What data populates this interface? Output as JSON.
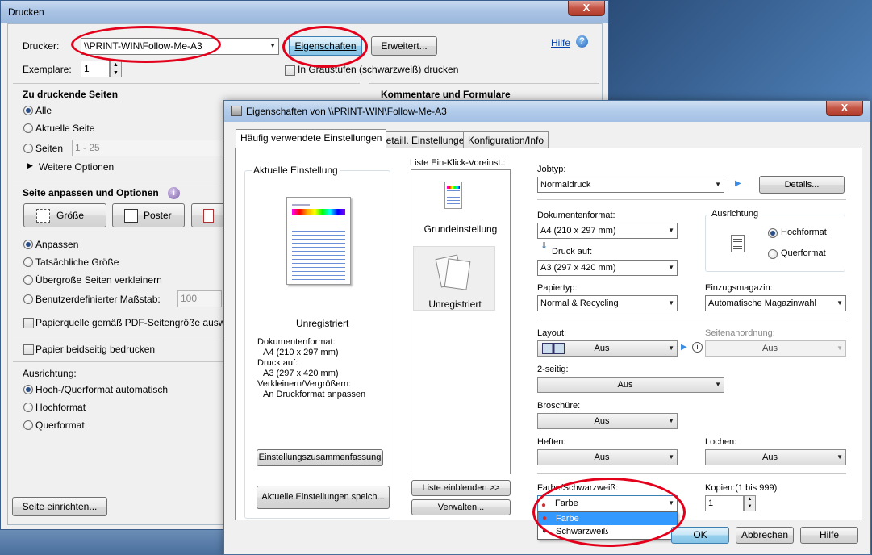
{
  "print_dialog": {
    "title": "Drucken",
    "close": "X",
    "printer_label": "Drucker:",
    "printer_value": "\\\\PRINT-WIN\\Follow-Me-A3",
    "properties_button": "Eigenschaften",
    "advanced_button": "Erweitert...",
    "help_link": "Hilfe",
    "copies_label": "Exemplare:",
    "copies_value": "1",
    "grayscale_label": "In Graustufen (schwarzweiß) drucken",
    "pages_heading": "Zu druckende Seiten",
    "pages_all": "Alle",
    "pages_current": "Aktuelle Seite",
    "pages_pages": "Seiten",
    "pages_range": "1 - 25",
    "more_options": "Weitere Optionen",
    "comments_heading": "Kommentare und Formulare",
    "fit_heading": "Seite anpassen und Optionen",
    "size_button": "Größe",
    "poster_button": "Poster",
    "fit_adjust": "Anpassen",
    "fit_actual": "Tatsächliche Größe",
    "fit_shrink": "Übergroße Seiten verkleinern",
    "fit_custom": "Benutzerdefinierter Maßstab:",
    "fit_custom_value": "100",
    "paper_source": "Papierquelle gemäß PDF-Seitengröße auswä",
    "duplex": "Papier beidseitig bedrucken",
    "orientation_label": "Ausrichtung:",
    "orient_auto": "Hoch-/Querformat automatisch",
    "orient_portrait": "Hochformat",
    "orient_landscape": "Querformat",
    "page_setup_button": "Seite einrichten..."
  },
  "properties_dialog": {
    "title": "Eigenschaften von \\\\PRINT-WIN\\Follow-Me-A3",
    "close": "X",
    "tabs": [
      "Häufig verwendete Einstellungen",
      "Detaill. Einstellungen",
      "Konfiguration/Info"
    ],
    "current_setting_title": "Aktuelle Einstellung",
    "unregistered": "Unregistriert",
    "summary_lines": [
      "Dokumentenformat:",
      "A4 (210 x 297 mm)",
      "Druck auf:",
      "A3 (297 x 420 mm)",
      "Verkleinern/Vergrößern:",
      "An Druckformat anpassen"
    ],
    "summary_button": "Einstellungszusammenfassung",
    "save_button": "Aktuelle Einstellungen speich...",
    "oneclick_title": "Liste Ein-Klick-Voreinst.:",
    "oneclick_items": [
      "Grundeinstellung",
      "Unregistriert"
    ],
    "show_list_button": "Liste einblenden >>",
    "manage_button": "Verwalten...",
    "jobtype_label": "Jobtyp:",
    "jobtype_value": "Normaldruck",
    "details_button": "Details...",
    "docformat_label": "Dokumentenformat:",
    "docformat_value": "A4 (210 x 297 mm)",
    "printon_label": "Druck auf:",
    "printon_value": "A3 (297 x 420 mm)",
    "orientation_title": "Ausrichtung",
    "orient_portrait": "Hochformat",
    "orient_landscape": "Querformat",
    "papertype_label": "Papiertyp:",
    "papertype_value": "Normal & Recycling",
    "tray_label": "Einzugsmagazin:",
    "tray_value": "Automatische Magazinwahl",
    "layout_label": "Layout:",
    "layout_value": "Aus",
    "pageorder_label": "Seitenanordnung:",
    "pageorder_value": "Aus",
    "duplex_label": "2-seitig:",
    "duplex_value": "Aus",
    "booklet_label": "Broschüre:",
    "booklet_value": "Aus",
    "staple_label": "Heften:",
    "staple_value": "Aus",
    "punch_label": "Lochen:",
    "punch_value": "Aus",
    "color_label": "Farbe/Schwarzweiß:",
    "color_value": "Farbe",
    "color_options": [
      "Farbe",
      "Schwarzweiß"
    ],
    "copies_label": "Kopien:(1 bis 999)",
    "copies_value": "1",
    "ok_button": "OK",
    "cancel_button": "Abbrechen",
    "help_button": "Hilfe"
  },
  "colors": {
    "highlight_red": "#e3001b",
    "selection_blue": "#3399ff",
    "titlebar_blue": "#a9c3e4"
  }
}
